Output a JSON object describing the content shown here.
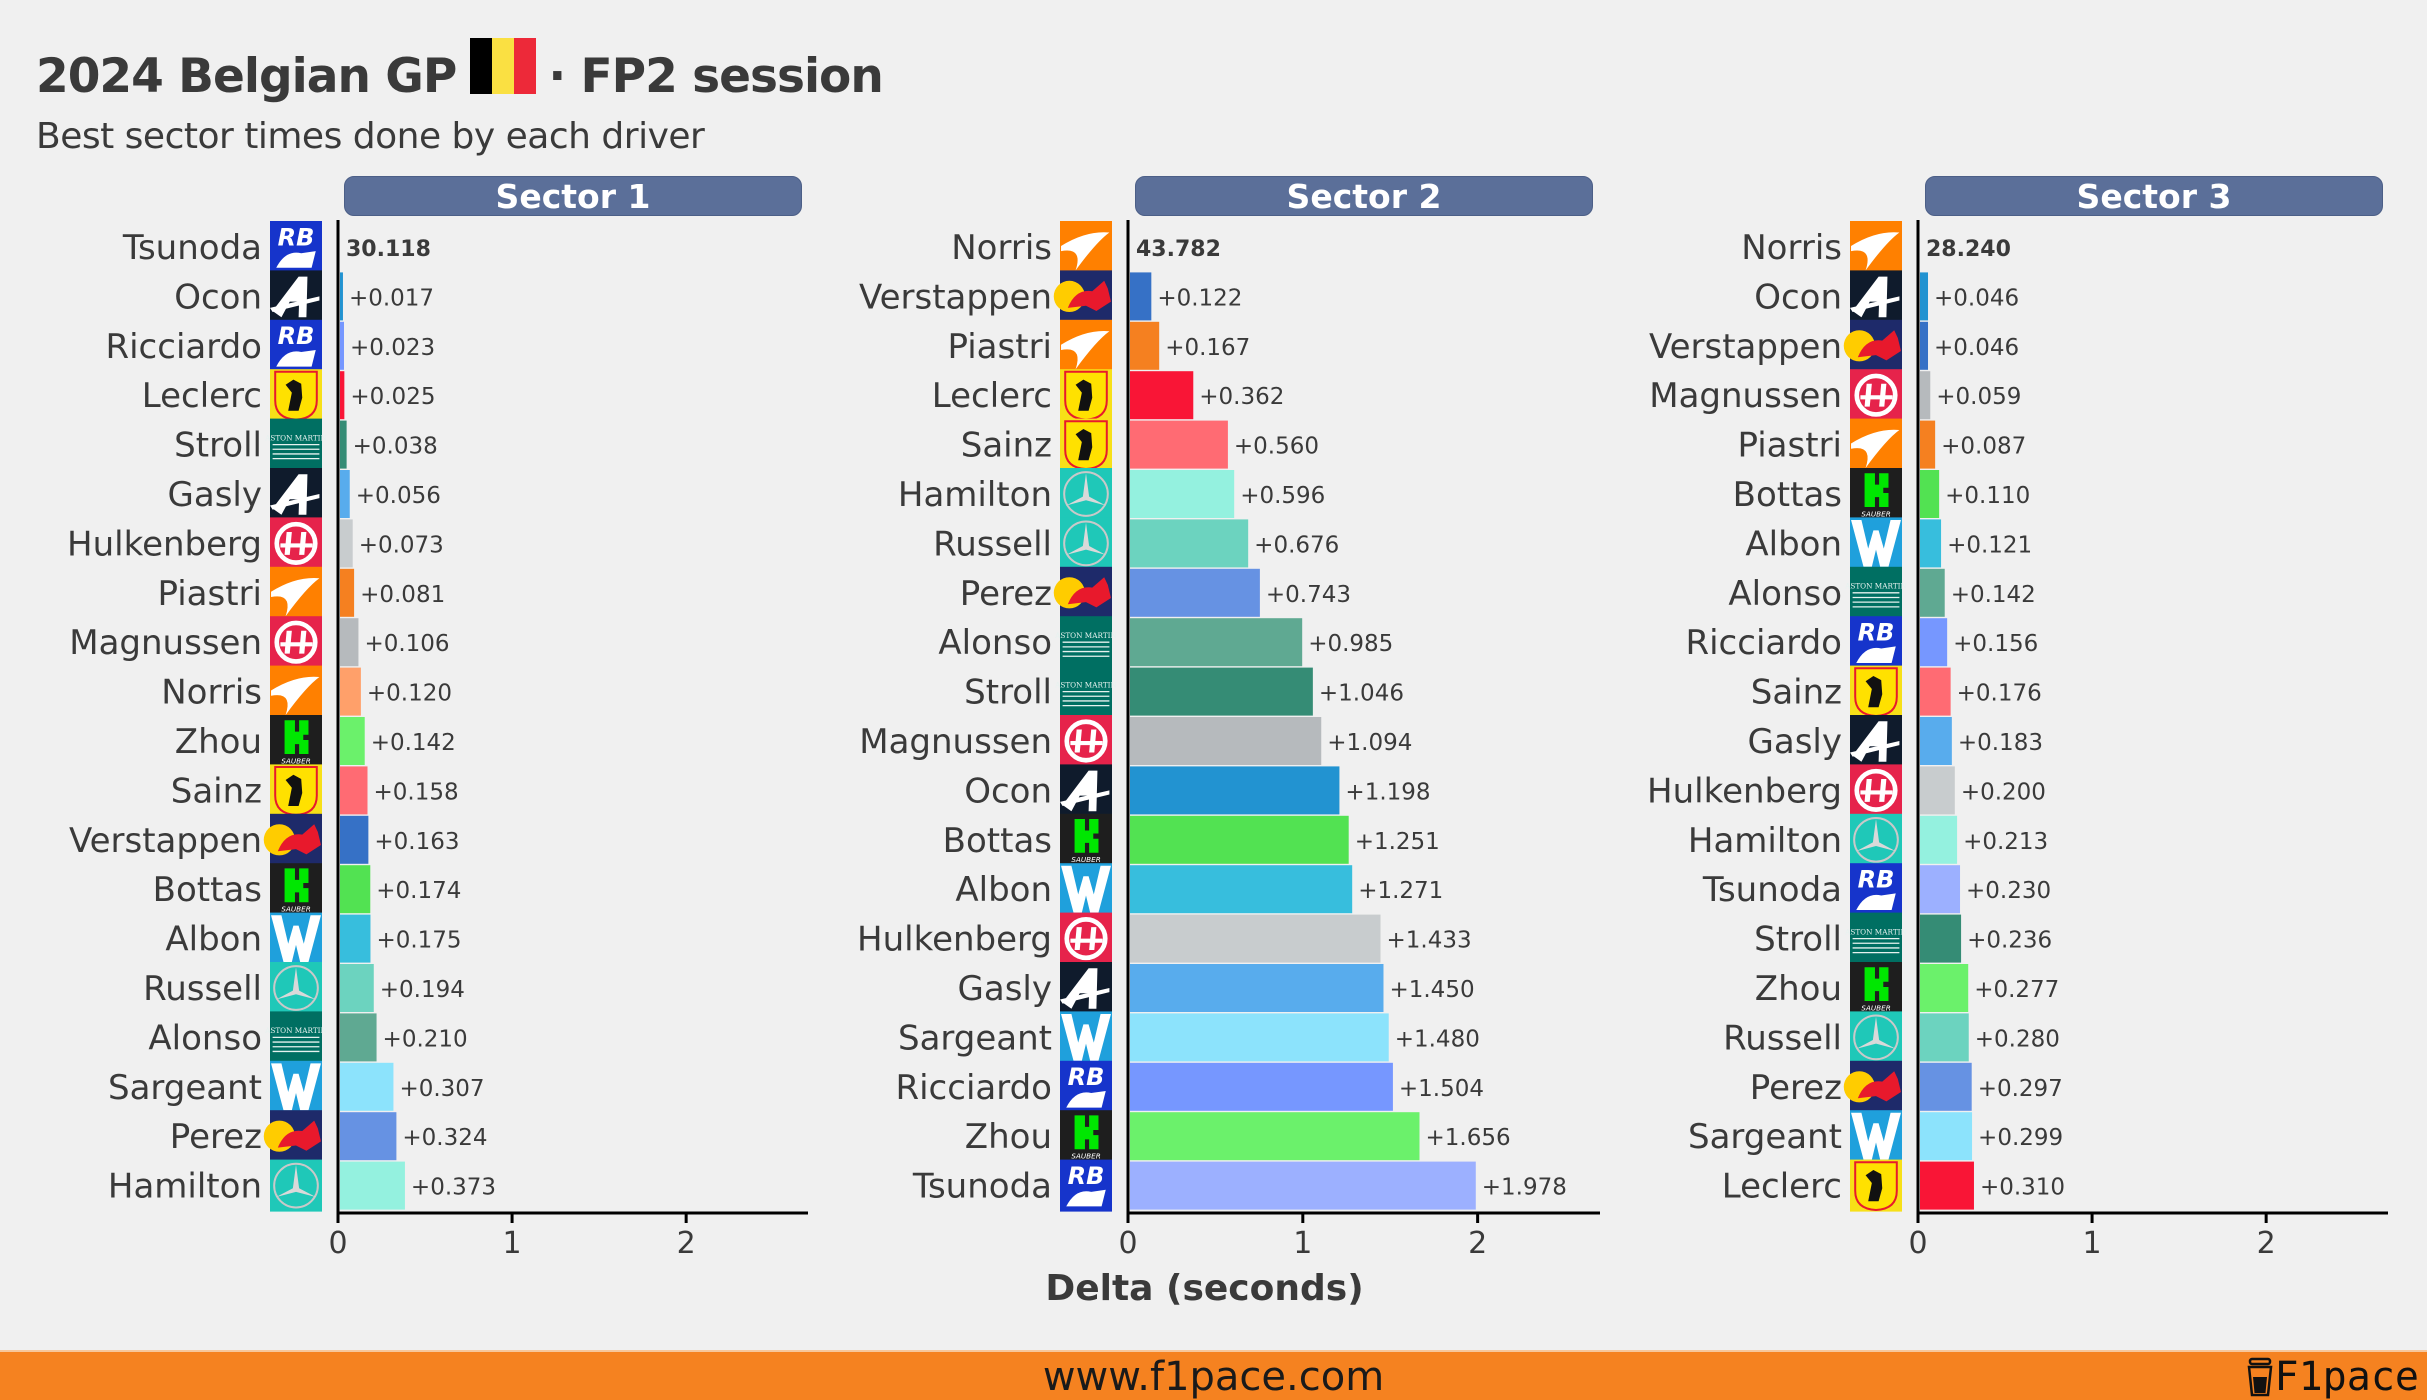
{
  "header": {
    "title_part1": "2024 Belgian GP",
    "title_part2": "· FP2 session",
    "flag_icon": "belgium-flag-icon",
    "flag_colors": [
      "#000000",
      "#fae042",
      "#ed2939"
    ],
    "subtitle": "Best sector times done by each driver"
  },
  "footer": {
    "url": "www.f1pace.com",
    "brand": "F1pace",
    "brand_icon": "coffee-cup-icon",
    "background": "#f58220"
  },
  "teams": {
    "rb": {
      "icon": "rb-bull-logo-icon",
      "bg": "#1634cb",
      "fg": "#ffffff"
    },
    "alpine": {
      "icon": "alpine-a-logo-icon",
      "bg": "#0f1b2c",
      "fg": "#ffffff"
    },
    "ferrari": {
      "icon": "ferrari-horse-logo-icon",
      "bg": "#f7e017",
      "fg": "#111111",
      "accent": "#e8192c"
    },
    "aston_martin": {
      "icon": "aston-martin-wings-logo-icon",
      "bg": "#006f62",
      "fg": "#e6f2ef"
    },
    "haas": {
      "icon": "haas-h-logo-icon",
      "bg": "#e6234b",
      "fg": "#ffffff"
    },
    "mclaren": {
      "icon": "mclaren-swoosh-logo-icon",
      "bg": "#ff8000",
      "fg": "#ffffff"
    },
    "sauber": {
      "icon": "kick-sauber-k-logo-icon",
      "bg": "#1e1e1e",
      "fg": "#00e701",
      "text": "SAUBER"
    },
    "red_bull": {
      "icon": "red-bull-logo-icon",
      "bg": "#1e2a6a",
      "fg": "#e8192c",
      "accent": "#ffcc00"
    },
    "williams": {
      "icon": "williams-w-logo-icon",
      "bg": "#1fa0dc",
      "fg": "#ffffff"
    },
    "mercedes": {
      "icon": "mercedes-star-logo-icon",
      "bg": "#1fc8b8",
      "fg": "#ffffff"
    }
  },
  "chart_data": [
    {
      "type": "bar",
      "orientation": "horizontal",
      "title": "Sector 1",
      "best_time": "30.118",
      "xlabel": "",
      "xlim": [
        0,
        2.7
      ],
      "xticks": [
        0,
        1,
        2
      ],
      "grid": false,
      "rows": [
        {
          "driver": "Tsunoda",
          "team": "rb",
          "delta": 0.0,
          "label": "30.118",
          "color": "#6c98ff"
        },
        {
          "driver": "Ocon",
          "team": "alpine",
          "delta": 0.017,
          "label": "+0.017",
          "color": "#2293d1"
        },
        {
          "driver": "Ricciardo",
          "team": "rb",
          "delta": 0.023,
          "label": "+0.023",
          "color": "#7697ff"
        },
        {
          "driver": "Leclerc",
          "team": "ferrari",
          "delta": 0.025,
          "label": "+0.025",
          "color": "#f91536"
        },
        {
          "driver": "Stroll",
          "team": "aston_martin",
          "delta": 0.038,
          "label": "+0.038",
          "color": "#358c75"
        },
        {
          "driver": "Gasly",
          "team": "alpine",
          "delta": 0.056,
          "label": "+0.056",
          "color": "#58aced"
        },
        {
          "driver": "Hulkenberg",
          "team": "haas",
          "delta": 0.073,
          "label": "+0.073",
          "color": "#c8ccce"
        },
        {
          "driver": "Piastri",
          "team": "mclaren",
          "delta": 0.081,
          "label": "+0.081",
          "color": "#f58020"
        },
        {
          "driver": "Magnussen",
          "team": "haas",
          "delta": 0.106,
          "label": "+0.106",
          "color": "#b6babd"
        },
        {
          "driver": "Norris",
          "team": "mclaren",
          "delta": 0.12,
          "label": "+0.120",
          "color": "#ffa06a"
        },
        {
          "driver": "Zhou",
          "team": "sauber",
          "delta": 0.142,
          "label": "+0.142",
          "color": "#6bf16b"
        },
        {
          "driver": "Sainz",
          "team": "ferrari",
          "delta": 0.158,
          "label": "+0.158",
          "color": "#ff6b73"
        },
        {
          "driver": "Verstappen",
          "team": "red_bull",
          "delta": 0.163,
          "label": "+0.163",
          "color": "#3671c6"
        },
        {
          "driver": "Bottas",
          "team": "sauber",
          "delta": 0.174,
          "label": "+0.174",
          "color": "#52e252"
        },
        {
          "driver": "Albon",
          "team": "williams",
          "delta": 0.175,
          "label": "+0.175",
          "color": "#37bedd"
        },
        {
          "driver": "Russell",
          "team": "mercedes",
          "delta": 0.194,
          "label": "+0.194",
          "color": "#6cd3bf"
        },
        {
          "driver": "Alonso",
          "team": "aston_martin",
          "delta": 0.21,
          "label": "+0.210",
          "color": "#5fa992"
        },
        {
          "driver": "Sargeant",
          "team": "williams",
          "delta": 0.307,
          "label": "+0.307",
          "color": "#8ce3fc"
        },
        {
          "driver": "Perez",
          "team": "red_bull",
          "delta": 0.324,
          "label": "+0.324",
          "color": "#6692e3"
        },
        {
          "driver": "Hamilton",
          "team": "mercedes",
          "delta": 0.373,
          "label": "+0.373",
          "color": "#94f1df"
        }
      ]
    },
    {
      "type": "bar",
      "orientation": "horizontal",
      "title": "Sector 2",
      "best_time": "43.782",
      "xlabel": "Delta (seconds)",
      "xlim": [
        0,
        2.7
      ],
      "xticks": [
        0,
        1,
        2
      ],
      "grid": false,
      "rows": [
        {
          "driver": "Norris",
          "team": "mclaren",
          "delta": 0.0,
          "label": "43.782",
          "color": "#ffa06a"
        },
        {
          "driver": "Verstappen",
          "team": "red_bull",
          "delta": 0.122,
          "label": "+0.122",
          "color": "#3671c6"
        },
        {
          "driver": "Piastri",
          "team": "mclaren",
          "delta": 0.167,
          "label": "+0.167",
          "color": "#f58020"
        },
        {
          "driver": "Leclerc",
          "team": "ferrari",
          "delta": 0.362,
          "label": "+0.362",
          "color": "#f91536"
        },
        {
          "driver": "Sainz",
          "team": "ferrari",
          "delta": 0.56,
          "label": "+0.560",
          "color": "#ff6b73"
        },
        {
          "driver": "Hamilton",
          "team": "mercedes",
          "delta": 0.596,
          "label": "+0.596",
          "color": "#94f1df"
        },
        {
          "driver": "Russell",
          "team": "mercedes",
          "delta": 0.676,
          "label": "+0.676",
          "color": "#6cd3bf"
        },
        {
          "driver": "Perez",
          "team": "red_bull",
          "delta": 0.743,
          "label": "+0.743",
          "color": "#6692e3"
        },
        {
          "driver": "Alonso",
          "team": "aston_martin",
          "delta": 0.985,
          "label": "+0.985",
          "color": "#5fa992"
        },
        {
          "driver": "Stroll",
          "team": "aston_martin",
          "delta": 1.046,
          "label": "+1.046",
          "color": "#358c75"
        },
        {
          "driver": "Magnussen",
          "team": "haas",
          "delta": 1.094,
          "label": "+1.094",
          "color": "#b6babd"
        },
        {
          "driver": "Ocon",
          "team": "alpine",
          "delta": 1.198,
          "label": "+1.198",
          "color": "#2293d1"
        },
        {
          "driver": "Bottas",
          "team": "sauber",
          "delta": 1.251,
          "label": "+1.251",
          "color": "#52e252"
        },
        {
          "driver": "Albon",
          "team": "williams",
          "delta": 1.271,
          "label": "+1.271",
          "color": "#37bedd"
        },
        {
          "driver": "Hulkenberg",
          "team": "haas",
          "delta": 1.433,
          "label": "+1.433",
          "color": "#c8ccce"
        },
        {
          "driver": "Gasly",
          "team": "alpine",
          "delta": 1.45,
          "label": "+1.450",
          "color": "#58aced"
        },
        {
          "driver": "Sargeant",
          "team": "williams",
          "delta": 1.48,
          "label": "+1.480",
          "color": "#8ce3fc"
        },
        {
          "driver": "Ricciardo",
          "team": "rb",
          "delta": 1.504,
          "label": "+1.504",
          "color": "#7697ff"
        },
        {
          "driver": "Zhou",
          "team": "sauber",
          "delta": 1.656,
          "label": "+1.656",
          "color": "#6bf16b"
        },
        {
          "driver": "Tsunoda",
          "team": "rb",
          "delta": 1.978,
          "label": "+1.978",
          "color": "#9cb0ff"
        }
      ]
    },
    {
      "type": "bar",
      "orientation": "horizontal",
      "title": "Sector 3",
      "best_time": "28.240",
      "xlabel": "",
      "xlim": [
        0,
        2.7
      ],
      "xticks": [
        0,
        1,
        2
      ],
      "grid": false,
      "rows": [
        {
          "driver": "Norris",
          "team": "mclaren",
          "delta": 0.0,
          "label": "28.240",
          "color": "#ffa06a"
        },
        {
          "driver": "Ocon",
          "team": "alpine",
          "delta": 0.046,
          "label": "+0.046",
          "color": "#2293d1"
        },
        {
          "driver": "Verstappen",
          "team": "red_bull",
          "delta": 0.046,
          "label": "+0.046",
          "color": "#3671c6"
        },
        {
          "driver": "Magnussen",
          "team": "haas",
          "delta": 0.059,
          "label": "+0.059",
          "color": "#b6babd"
        },
        {
          "driver": "Piastri",
          "team": "mclaren",
          "delta": 0.087,
          "label": "+0.087",
          "color": "#f58020"
        },
        {
          "driver": "Bottas",
          "team": "sauber",
          "delta": 0.11,
          "label": "+0.110",
          "color": "#52e252"
        },
        {
          "driver": "Albon",
          "team": "williams",
          "delta": 0.121,
          "label": "+0.121",
          "color": "#37bedd"
        },
        {
          "driver": "Alonso",
          "team": "aston_martin",
          "delta": 0.142,
          "label": "+0.142",
          "color": "#5fa992"
        },
        {
          "driver": "Ricciardo",
          "team": "rb",
          "delta": 0.156,
          "label": "+0.156",
          "color": "#7697ff"
        },
        {
          "driver": "Sainz",
          "team": "ferrari",
          "delta": 0.176,
          "label": "+0.176",
          "color": "#ff6b73"
        },
        {
          "driver": "Gasly",
          "team": "alpine",
          "delta": 0.183,
          "label": "+0.183",
          "color": "#58aced"
        },
        {
          "driver": "Hulkenberg",
          "team": "haas",
          "delta": 0.2,
          "label": "+0.200",
          "color": "#c8ccce"
        },
        {
          "driver": "Hamilton",
          "team": "mercedes",
          "delta": 0.213,
          "label": "+0.213",
          "color": "#94f1df"
        },
        {
          "driver": "Tsunoda",
          "team": "rb",
          "delta": 0.23,
          "label": "+0.230",
          "color": "#9cb0ff"
        },
        {
          "driver": "Stroll",
          "team": "aston_martin",
          "delta": 0.236,
          "label": "+0.236",
          "color": "#358c75"
        },
        {
          "driver": "Zhou",
          "team": "sauber",
          "delta": 0.277,
          "label": "+0.277",
          "color": "#6bf16b"
        },
        {
          "driver": "Russell",
          "team": "mercedes",
          "delta": 0.28,
          "label": "+0.280",
          "color": "#6cd3bf"
        },
        {
          "driver": "Perez",
          "team": "red_bull",
          "delta": 0.297,
          "label": "+0.297",
          "color": "#6692e3"
        },
        {
          "driver": "Sargeant",
          "team": "williams",
          "delta": 0.299,
          "label": "+0.299",
          "color": "#8ce3fc"
        },
        {
          "driver": "Leclerc",
          "team": "ferrari",
          "delta": 0.31,
          "label": "+0.310",
          "color": "#f91536"
        }
      ]
    }
  ]
}
